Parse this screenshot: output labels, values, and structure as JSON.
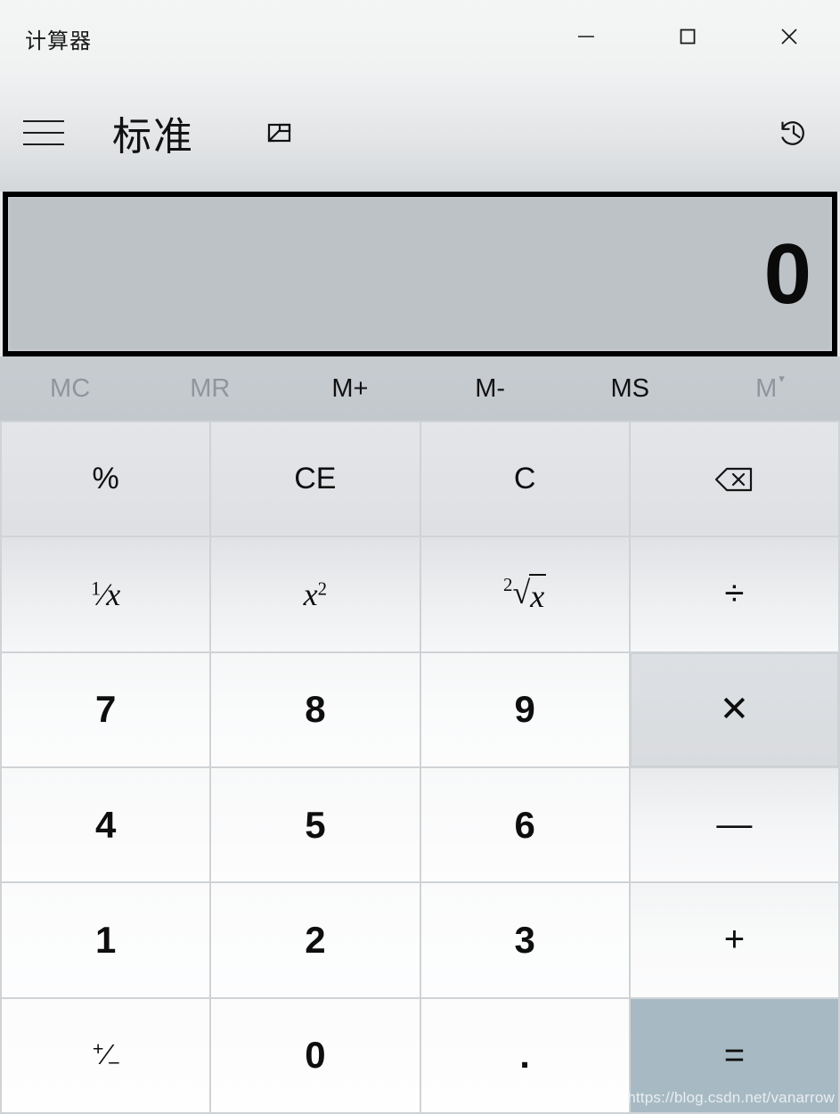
{
  "window": {
    "title": "计算器",
    "controls": [
      {
        "name": "minimize",
        "glyph": "—",
        "label": "最小化"
      },
      {
        "name": "maximize",
        "glyph": "□",
        "label": "最大化"
      },
      {
        "name": "close",
        "glyph": "✕",
        "label": "关闭"
      }
    ]
  },
  "nav": {
    "menu_icon": "hamburger-icon",
    "mode_title": "标准",
    "keep_on_top_icon": "keep-on-top-icon",
    "history_icon": "history-icon"
  },
  "display": {
    "value": "0",
    "background_color": "#bdc2c7",
    "focus_border_color": "#000000"
  },
  "memory": {
    "keys": [
      {
        "label": "MC",
        "enabled": false
      },
      {
        "label": "MR",
        "enabled": false
      },
      {
        "label": "M+",
        "enabled": true
      },
      {
        "label": "M-",
        "enabled": true
      },
      {
        "label": "MS",
        "enabled": true
      },
      {
        "label": "M",
        "enabled": false,
        "chevron": "▾"
      }
    ]
  },
  "keypad": {
    "rows": [
      [
        {
          "key": "percent",
          "label": "%",
          "kind": "fn"
        },
        {
          "key": "clear-entry",
          "label": "CE",
          "kind": "fn"
        },
        {
          "key": "clear",
          "label": "C",
          "kind": "fn"
        },
        {
          "key": "backspace",
          "label": "",
          "kind": "fn",
          "icon": "backspace-icon"
        }
      ],
      [
        {
          "key": "reciprocal",
          "label": "1/x",
          "kind": "fn"
        },
        {
          "key": "square",
          "label": "x2",
          "kind": "fn"
        },
        {
          "key": "square-root",
          "label": "2√x",
          "kind": "fn"
        },
        {
          "key": "divide",
          "label": "÷",
          "kind": "op"
        }
      ],
      [
        {
          "key": "seven",
          "label": "7",
          "kind": "num"
        },
        {
          "key": "eight",
          "label": "8",
          "kind": "num"
        },
        {
          "key": "nine",
          "label": "9",
          "kind": "num"
        },
        {
          "key": "multiply",
          "label": "✕",
          "kind": "op"
        }
      ],
      [
        {
          "key": "four",
          "label": "4",
          "kind": "num"
        },
        {
          "key": "five",
          "label": "5",
          "kind": "num"
        },
        {
          "key": "six",
          "label": "6",
          "kind": "num"
        },
        {
          "key": "subtract",
          "label": "—",
          "kind": "op"
        }
      ],
      [
        {
          "key": "one",
          "label": "1",
          "kind": "num"
        },
        {
          "key": "two",
          "label": "2",
          "kind": "num"
        },
        {
          "key": "three",
          "label": "3",
          "kind": "num"
        },
        {
          "key": "add",
          "label": "+",
          "kind": "op"
        }
      ],
      [
        {
          "key": "negate",
          "label": "+/−",
          "kind": "num"
        },
        {
          "key": "zero",
          "label": "0",
          "kind": "num"
        },
        {
          "key": "decimal",
          "label": ".",
          "kind": "num"
        },
        {
          "key": "equals",
          "label": "=",
          "kind": "equals"
        }
      ]
    ],
    "equals_accent_color": "#a7bac4"
  },
  "watermark": {
    "text": "https://blog.csdn.net/vanarrow"
  }
}
